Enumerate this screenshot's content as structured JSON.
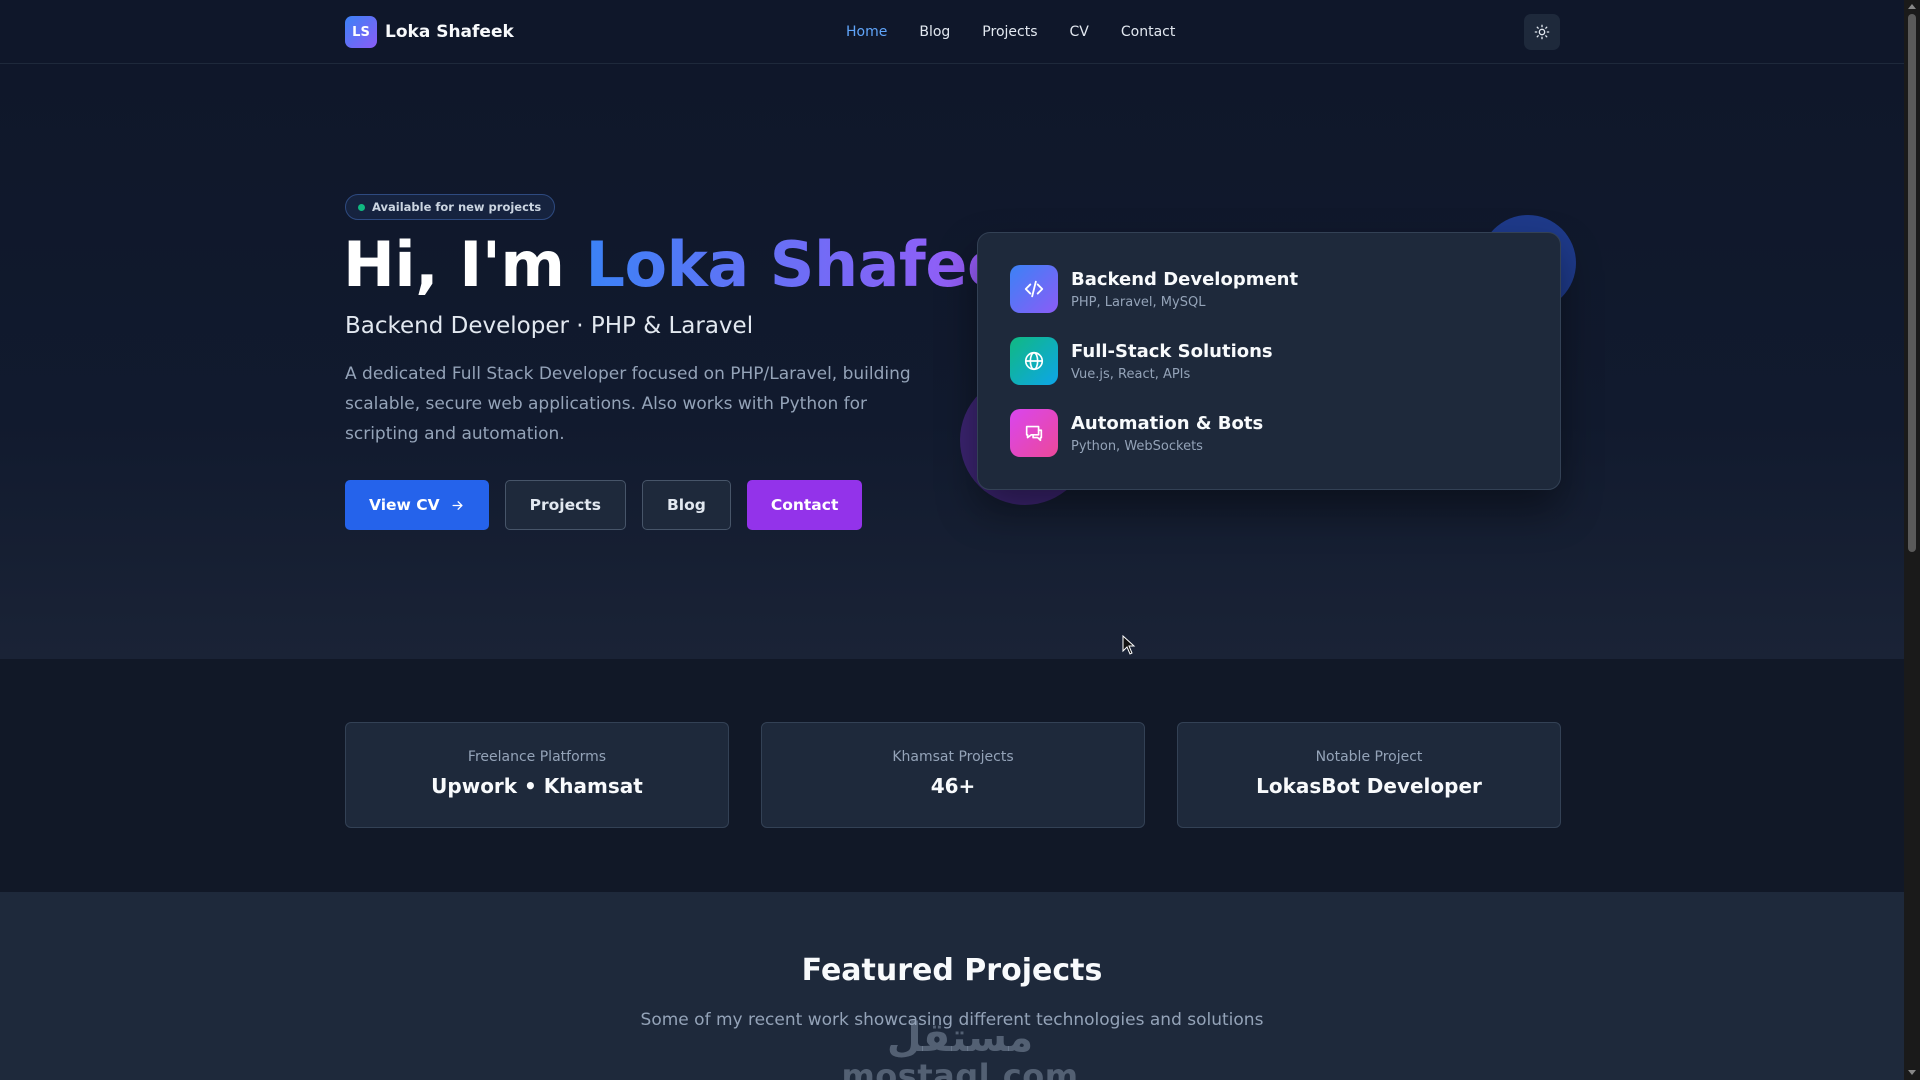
{
  "nav": {
    "logo_initials": "LS",
    "brand_name": "Loka Shafeek",
    "links": [
      "Home",
      "Blog",
      "Projects",
      "CV",
      "Contact"
    ],
    "active_link": "Home",
    "theme_toggle_icon": "sun-icon"
  },
  "hero": {
    "badge": "Available for new projects",
    "title_prefix": "Hi, I'm",
    "title_name": "Loka Shafeek",
    "subtitle": "Backend Developer · PHP & Laravel",
    "description": "A dedicated Full Stack Developer focused on PHP/Laravel, building scalable, secure web applications. Also works with Python for scripting and automation.",
    "buttons": {
      "view_cv": "View CV",
      "projects": "Projects",
      "blog": "Blog",
      "contact": "Contact"
    }
  },
  "skills": [
    {
      "title": "Backend Development",
      "subtitle": "PHP, Laravel, MySQL",
      "icon": "code-icon"
    },
    {
      "title": "Full-Stack Solutions",
      "subtitle": "Vue.js, React, APIs",
      "icon": "globe-icon"
    },
    {
      "title": "Automation & Bots",
      "subtitle": "Python, WebSockets",
      "icon": "chat-icon"
    }
  ],
  "stats": [
    {
      "label": "Freelance Platforms",
      "value": "Upwork • Khamsat"
    },
    {
      "label": "Khamsat Projects",
      "value": "46+"
    },
    {
      "label": "Notable Project",
      "value": "LokasBot Developer"
    }
  ],
  "featured": {
    "title": "Featured Projects",
    "subtitle": "Some of my recent work showcasing different technologies and solutions"
  },
  "watermark": {
    "arabic": "مستقل",
    "latin": "mostaql.com"
  },
  "colors": {
    "background": "#0f172a",
    "accent_blue": "#2563eb",
    "accent_purple": "#9333ea",
    "active_link": "#60a5fa"
  }
}
